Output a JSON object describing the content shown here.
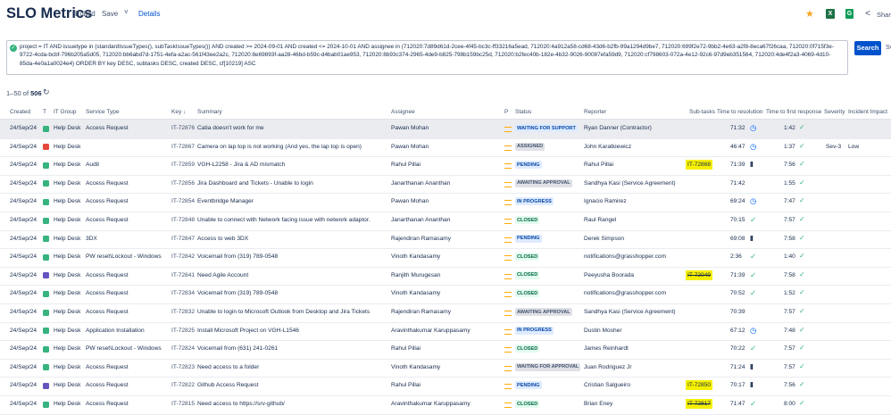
{
  "header": {
    "title": "SLO Metrics",
    "edited": "Edited",
    "save": "Save",
    "save_caret": "˅",
    "details": "Details",
    "share": "Shar"
  },
  "jql": {
    "query": "project = IT AND issuetype in (standardIssueTypes(), subTaskIssueTypes()) AND created >= 2024-09-01 AND created <= 2024-10-01 AND assignee in (712020:7d89d61d-2cee-4f45-bc3c-ff33216a5ead, 712020:4a912a58-cd68-43d6-b2fb-99a1294d9be7, 712020:699f2e72-9bb2-4e63-a2f8-8eca67f26caa, 712020:0f715f3e-9722-4cda-bcbf-796b205a5d05, 712020:bb6abd7d-1751-4efa-a2ac-561f43ee2a2c, 712020:8e69893f-aa28-46bd-b59c-d4bab01ae953, 712020:8b93c374-2965-4de9-b825-798b159bc25d, 712020:b2fec40b-182e-4b32-9026-90087efa59d9, 712020:cf798603-072a-4e12-92c6-97d9eb351564, 712020:4de4f2a3-4069-4d10-85da-4e0a1a0024e4) ORDER BY key DESC, subtasks DESC, created DESC, cf[10219] ASC",
    "search_label": "Search",
    "search_extra": "Sv"
  },
  "results": {
    "range": "1–50",
    "of": "of",
    "total": "506"
  },
  "columns": {
    "created": "Created",
    "t": "T",
    "group": "IT Group",
    "service": "Service Type",
    "key": "Key",
    "summary": "Summary",
    "assignee": "Assignee",
    "p": "P",
    "status": "Status",
    "reporter": "Reporter",
    "subtasks": "Sub-tasks",
    "ttr": "Time to resolution",
    "tfr": "Time to first response",
    "severity": "Severity",
    "impact": "Incident Impact"
  },
  "colors": {
    "accent": "#0052cc",
    "highlight": "#f6f000",
    "success": "#36b37e"
  },
  "rows": [
    {
      "created": "24/Sep/24",
      "type": "green",
      "group": "Help Desk",
      "service": "Access Request",
      "key": "IT-72876",
      "summary": "Catia doesn't work for me",
      "assignee": "Pawan Mohan",
      "status": "WAITING FOR SUPPORT",
      "status_color": "blue",
      "reporter": "Ryan Danner (Contractor)",
      "subtask": "",
      "subtask_style": "",
      "ttr": "71:32",
      "ttr_icon": "◷",
      "ttr_icon_style": "",
      "tfr": "1:42",
      "severity": "",
      "impact": ""
    },
    {
      "created": "24/Sep/24",
      "type": "red",
      "group": "Help Desk",
      "service": "",
      "key": "IT-72867",
      "summary": "Camera on lap top is not working (And yes, the lap top is open)",
      "assignee": "Pawan Mohan",
      "status": "ASSIGNED",
      "status_color": "grey",
      "reporter": "John Karatkiewicz",
      "subtask": "",
      "subtask_style": "",
      "ttr": "46:47",
      "ttr_icon": "◷",
      "ttr_icon_style": "",
      "tfr": "1:37",
      "severity": "Sev-3",
      "impact": "Low"
    },
    {
      "created": "24/Sep/24",
      "type": "green",
      "group": "Help Desk",
      "service": "Audit",
      "key": "IT-72859",
      "summary": "VGH-L2258 - Jira & AD mismatch",
      "assignee": "Rahul Pillai",
      "status": "PENDING",
      "status_color": "blue",
      "reporter": "Rahul Pillai",
      "subtask": "IT-72868",
      "subtask_style": "hl",
      "ttr": "71:39",
      "ttr_icon": "II",
      "ttr_icon_style": "dark",
      "tfr": "7:56",
      "severity": "",
      "impact": ""
    },
    {
      "created": "24/Sep/24",
      "type": "green",
      "group": "Help Desk",
      "service": "Access Request",
      "key": "IT-72856",
      "summary": "Jira Dashboard and Tickets - Unable to login",
      "assignee": "Janarthanan Ananthan",
      "status": "AWAITING APPROVAL",
      "status_color": "grey",
      "reporter": "Sandhya Kasi (Service Agreement)",
      "subtask": "",
      "subtask_style": "",
      "ttr": "71:42",
      "ttr_icon": "",
      "ttr_icon_style": "",
      "tfr": "1:55",
      "severity": "",
      "impact": ""
    },
    {
      "created": "24/Sep/24",
      "type": "green",
      "group": "Help Desk",
      "service": "Access Request",
      "key": "IT-72854",
      "summary": "Eventbridge Manager",
      "assignee": "Pawan Mohan",
      "status": "IN PROGRESS",
      "status_color": "blue",
      "reporter": "Ignacio Ramirez",
      "subtask": "",
      "subtask_style": "",
      "ttr": "69:24",
      "ttr_icon": "◷",
      "ttr_icon_style": "",
      "tfr": "7:47",
      "severity": "",
      "impact": ""
    },
    {
      "created": "24/Sep/24",
      "type": "green",
      "group": "Help Desk",
      "service": "Access Request",
      "key": "IT-72848",
      "summary": "Unable to connect with Network facing issue with network adaptor.",
      "assignee": "Janarthanan Ananthan",
      "status": "CLOSED",
      "status_color": "green",
      "reporter": "Raul Rangel",
      "subtask": "",
      "subtask_style": "",
      "ttr": "70:15",
      "ttr_icon": "✓",
      "ttr_icon_style": "green",
      "tfr": "7:57",
      "severity": "",
      "impact": ""
    },
    {
      "created": "24/Sep/24",
      "type": "green",
      "group": "Help Desk",
      "service": "3DX",
      "key": "IT-72847",
      "summary": "Access to web 3DX",
      "assignee": "Rajendiran Ramasamy",
      "status": "PENDING",
      "status_color": "blue",
      "reporter": "Derek Simpson",
      "subtask": "",
      "subtask_style": "",
      "ttr": "69:08",
      "ttr_icon": "II",
      "ttr_icon_style": "dark",
      "tfr": "7:58",
      "severity": "",
      "impact": ""
    },
    {
      "created": "24/Sep/24",
      "type": "green",
      "group": "Help Desk",
      "service": "PW reset\\Lockout - Windows",
      "key": "IT-72842",
      "summary": "Voicemail from (319) 789-0548",
      "assignee": "Vinoth Kandasamy",
      "status": "CLOSED",
      "status_color": "green",
      "reporter": "notifications@grasshopper.com",
      "subtask": "",
      "subtask_style": "",
      "ttr": "2:36",
      "ttr_icon": "✓",
      "ttr_icon_style": "green",
      "tfr": "1:40",
      "severity": "",
      "impact": ""
    },
    {
      "created": "24/Sep/24",
      "type": "purple",
      "group": "Help Desk",
      "service": "Access Request",
      "key": "IT-72841",
      "summary": "Need Agile Account",
      "assignee": "Ranjith Murugesan",
      "status": "CLOSED",
      "status_color": "green",
      "reporter": "Peeyusha Boorada",
      "subtask": "IT-72049",
      "subtask_style": "hl-strike",
      "ttr": "71:39",
      "ttr_icon": "✓",
      "ttr_icon_style": "green",
      "tfr": "7:58",
      "severity": "",
      "impact": ""
    },
    {
      "created": "24/Sep/24",
      "type": "green",
      "group": "Help Desk",
      "service": "Access Request",
      "key": "IT-72834",
      "summary": "Voicemail from (319) 789-0548",
      "assignee": "Vinoth Kandasamy",
      "status": "CLOSED",
      "status_color": "green",
      "reporter": "notifications@grasshopper.com",
      "subtask": "",
      "subtask_style": "",
      "ttr": "70:52",
      "ttr_icon": "✓",
      "ttr_icon_style": "green",
      "tfr": "1:52",
      "severity": "",
      "impact": ""
    },
    {
      "created": "24/Sep/24",
      "type": "green",
      "group": "Help Desk",
      "service": "Access Request",
      "key": "IT-72832",
      "summary": "Unable to login to Microsoft Outlook from Desktop and Jira Tickets",
      "assignee": "Rajendiran Ramasamy",
      "status": "AWAITING APPROVAL",
      "status_color": "grey",
      "reporter": "Sandhya Kasi (Service Agreement)",
      "subtask": "",
      "subtask_style": "",
      "ttr": "70:39",
      "ttr_icon": "",
      "ttr_icon_style": "",
      "tfr": "7:57",
      "severity": "",
      "impact": ""
    },
    {
      "created": "24/Sep/24",
      "type": "green",
      "group": "Help Desk",
      "service": "Application Installation",
      "key": "IT-72825",
      "summary": "Install Microsoft Project on VGH-L1546",
      "assignee": "Aravinthakumar Karuppasamy",
      "status": "IN PROGRESS",
      "status_color": "blue",
      "reporter": "Dustin Mosher",
      "subtask": "",
      "subtask_style": "",
      "ttr": "67:12",
      "ttr_icon": "◷",
      "ttr_icon_style": "",
      "tfr": "7:48",
      "severity": "",
      "impact": ""
    },
    {
      "created": "24/Sep/24",
      "type": "green",
      "group": "Help Desk",
      "service": "PW reset\\Lockout - Windows",
      "key": "IT-72824",
      "summary": "Voicemail from (631) 241-0261",
      "assignee": "Rahul Pillai",
      "status": "CLOSED",
      "status_color": "green",
      "reporter": "James Reinhardt",
      "subtask": "",
      "subtask_style": "",
      "ttr": "70:22",
      "ttr_icon": "✓",
      "ttr_icon_style": "green",
      "tfr": "7:57",
      "severity": "",
      "impact": ""
    },
    {
      "created": "24/Sep/24",
      "type": "green",
      "group": "Help Desk",
      "service": "Access Request",
      "key": "IT-72823",
      "summary": "Need access to a folder",
      "assignee": "Vinoth Kandasamy",
      "status": "WAITING FOR APPROVAL",
      "status_color": "grey",
      "reporter": "Juan Rodriguez Jr",
      "subtask": "",
      "subtask_style": "",
      "ttr": "71:24",
      "ttr_icon": "II",
      "ttr_icon_style": "dark",
      "tfr": "7:57",
      "severity": "",
      "impact": ""
    },
    {
      "created": "24/Sep/24",
      "type": "purple",
      "group": "Help Desk",
      "service": "Access Request",
      "key": "IT-72822",
      "summary": "Github Access Request",
      "assignee": "Rahul Pillai",
      "status": "PENDING",
      "status_color": "blue",
      "reporter": "Cristian Salgueiro",
      "subtask": "IT-72850",
      "subtask_style": "hl",
      "ttr": "70:17",
      "ttr_icon": "II",
      "ttr_icon_style": "dark",
      "tfr": "7:56",
      "severity": "",
      "impact": ""
    },
    {
      "created": "24/Sep/24",
      "type": "green",
      "group": "Help Desk",
      "service": "Access Request",
      "key": "IT-72815",
      "summary": "Need access to https://srv-github/",
      "assignee": "Aravinthakumar Karuppasamy",
      "status": "CLOSED",
      "status_color": "green",
      "reporter": "Brian Eney",
      "subtask": "IT-72817",
      "subtask_style": "hl-strike",
      "ttr": "71:47",
      "ttr_icon": "✓",
      "ttr_icon_style": "green",
      "tfr": "8:00",
      "severity": "",
      "impact": ""
    }
  ]
}
